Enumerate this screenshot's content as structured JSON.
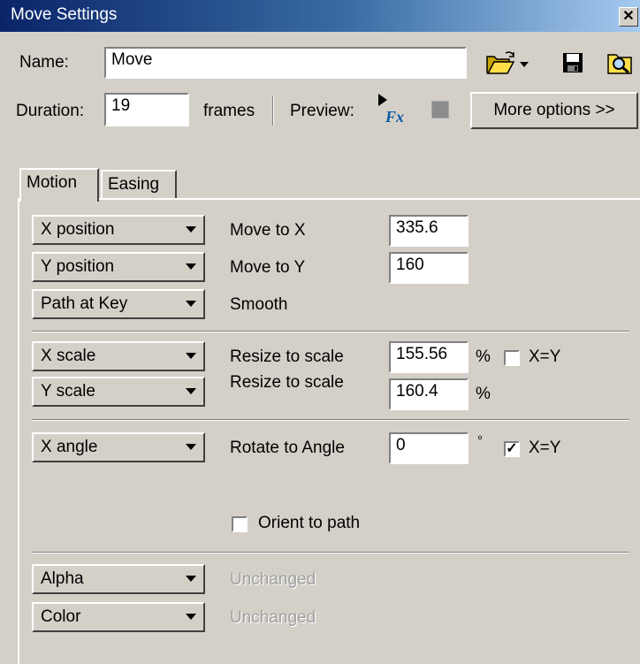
{
  "window": {
    "title": "Move Settings",
    "close": "✕"
  },
  "header": {
    "name_label": "Name:",
    "name_value": "Move",
    "duration_label": "Duration:",
    "duration_value": "19",
    "frames_label": "frames",
    "preview_label": "Preview:",
    "more_options": "More options >>",
    "preview_icon_text": "Fx"
  },
  "tabs": [
    {
      "label": "Motion",
      "active": true
    },
    {
      "label": "Easing",
      "active": false
    }
  ],
  "motion": {
    "position": {
      "x_dropdown": "X position",
      "x_action": "Move to X",
      "x_value": "335.6",
      "y_dropdown": "Y position",
      "y_action": "Move to Y",
      "y_value": "160",
      "path_dropdown": "Path at Key",
      "path_value": "Smooth"
    },
    "scale": {
      "x_dropdown": "X scale",
      "x_action": "Resize to scale",
      "x_value": "155.56",
      "x_unit": "%",
      "xy_lock_label": "X=Y",
      "xy_lock_checked": false,
      "y_dropdown": "Y scale",
      "y_action": "Resize to scale",
      "y_value": "160.4",
      "y_unit": "%"
    },
    "rotation": {
      "dropdown": "X angle",
      "action": "Rotate to Angle",
      "value": "0",
      "unit": "°",
      "xy_lock_label": "X=Y",
      "xy_lock_checked": true,
      "orient_label": "Orient to path",
      "orient_checked": false
    },
    "appearance": {
      "alpha_dropdown": "Alpha",
      "alpha_value": "Unchanged",
      "color_dropdown": "Color",
      "color_value": "Unchanged"
    }
  },
  "colors": {
    "titlebar": "#0a246a",
    "face": "#d4d0c8",
    "disabled_text": "#a0a0a0"
  }
}
